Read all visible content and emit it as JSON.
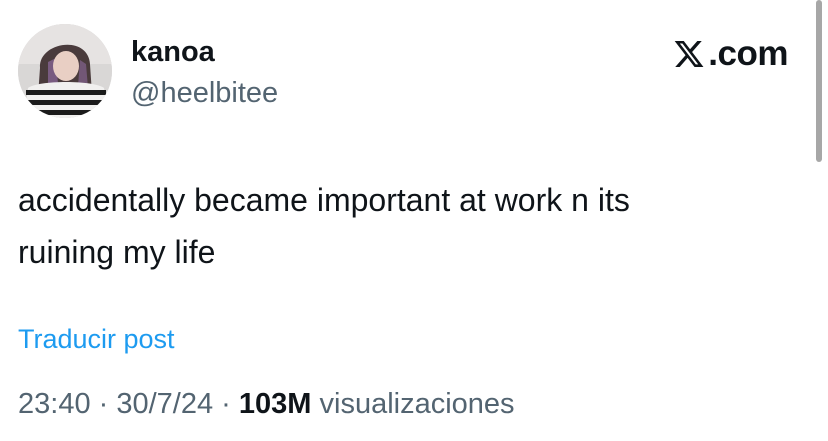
{
  "user": {
    "display_name": "kanoa",
    "handle": "@heelbitee",
    "avatar_icon": "profile-photo-avatar"
  },
  "brand": {
    "logo_icon": "x-logo-icon",
    "text": ".com"
  },
  "tweet": {
    "line1": "accidentally became important at work n its",
    "line2": "ruining my life",
    "translate_label": "Traducir post"
  },
  "meta": {
    "time": "23:40",
    "separator1": " · ",
    "date": "30/7/24",
    "separator2": " · ",
    "views_count": "103M",
    "views_label": " visualizaciones"
  },
  "colors": {
    "link": "#1d9bf0",
    "secondary": "#536471",
    "primary": "#0f1419"
  }
}
